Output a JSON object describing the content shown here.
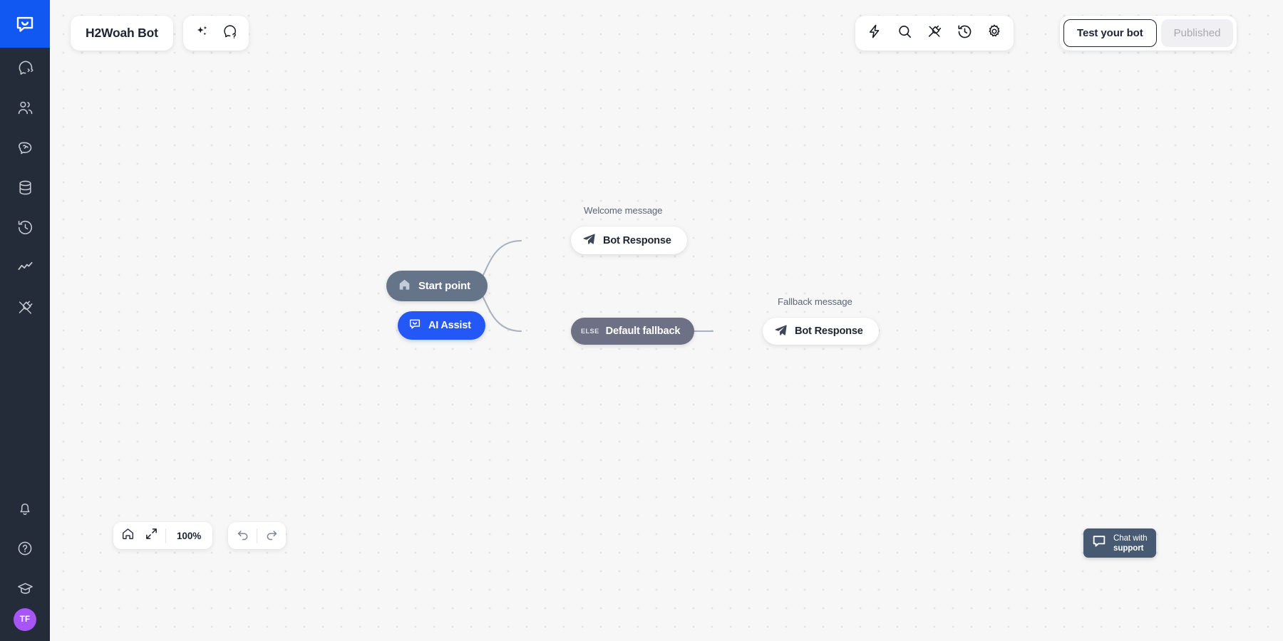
{
  "sidebar": {
    "logo": {
      "icon": "chat-bubble-logo-icon",
      "color": "#1158f2"
    },
    "items": [
      {
        "icon": "chat-code-icon",
        "name": "sidebar-item-flows"
      },
      {
        "icon": "users-icon",
        "name": "sidebar-item-contacts"
      },
      {
        "icon": "brain-icon",
        "name": "sidebar-item-ai-knowledge"
      },
      {
        "icon": "database-icon",
        "name": "sidebar-item-data"
      },
      {
        "icon": "history-icon",
        "name": "sidebar-item-history"
      },
      {
        "icon": "analytics-icon",
        "name": "sidebar-item-analytics"
      },
      {
        "icon": "plug-icon",
        "name": "sidebar-item-integrations"
      }
    ],
    "bottom_items": [
      {
        "icon": "bell-icon",
        "name": "sidebar-item-notifications"
      },
      {
        "icon": "help-circle-icon",
        "name": "sidebar-item-help"
      },
      {
        "icon": "graduation-cap-icon",
        "name": "sidebar-item-academy"
      }
    ],
    "avatar": {
      "initials": "TF",
      "color": "#a855f7"
    }
  },
  "header": {
    "bot_name": "H2Woah Bot",
    "title_tools": [
      {
        "icon": "sparkles-icon",
        "name": "ai-magic-button"
      },
      {
        "icon": "chat-help-icon",
        "name": "chat-help-button"
      }
    ],
    "top_tools": [
      {
        "icon": "lightning-icon",
        "name": "triggers-button"
      },
      {
        "icon": "search-icon",
        "name": "search-button"
      },
      {
        "icon": "plug-icon",
        "name": "integrations-button"
      },
      {
        "icon": "history-icon",
        "name": "version-history-button"
      },
      {
        "icon": "gear-icon",
        "name": "settings-button"
      }
    ],
    "test_bot_label": "Test your bot",
    "published_label": "Published"
  },
  "flow": {
    "nodes": [
      {
        "id": "start",
        "title": "Start point",
        "icon": "home-icon",
        "color": "#667489"
      },
      {
        "id": "ai_assist",
        "title": "AI Assist",
        "icon": "chat-smile-icon",
        "color": "#2357f6"
      },
      {
        "id": "welcome",
        "title": "Bot Response",
        "icon": "send-icon",
        "color": "#ffffff"
      },
      {
        "id": "fallback",
        "title": "Default fallback",
        "badge": "ELSE",
        "color": "#6e7185"
      },
      {
        "id": "fallback_msg",
        "title": "Bot Response",
        "icon": "send-icon",
        "color": "#ffffff"
      }
    ],
    "labels": {
      "welcome": "Welcome message",
      "fallback": "Fallback message"
    }
  },
  "controls": {
    "zoom": {
      "home_icon": "home-icon",
      "fit_icon": "fit-screen-icon",
      "level": "100%"
    },
    "undo_icon": "undo-icon",
    "redo_icon": "redo-icon"
  },
  "support": {
    "icon": "chat-bubble-icon",
    "line1": "Chat with",
    "line2": "support"
  }
}
